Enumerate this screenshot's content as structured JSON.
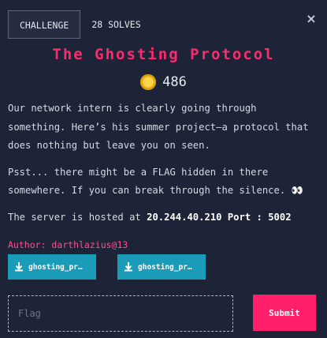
{
  "tabs": {
    "challenge": "CHALLENGE",
    "solves": "28 SOLVES"
  },
  "close_icon": "×",
  "title": "The Ghosting Protocol",
  "points": "486",
  "description": {
    "p1": "Our network intern is clearly going through something. Here’s his summer project—a protocol that does nothing but leave you on seen.",
    "p2": "Psst... there might be a FLAG hidden in there somewhere. If you can break through the silence. 👀",
    "p3_prefix": "The server is hosted at ",
    "p3_address": "20.244.40.210 Port : 5002"
  },
  "author": "Author: darthlazius@13",
  "downloads": [
    {
      "label": "ghosting_pr…"
    },
    {
      "label": "ghosting_pr…"
    }
  ],
  "flag_input": {
    "placeholder": "Flag",
    "value": ""
  },
  "submit_label": "Submit",
  "colors": {
    "accent": "#ff2a6d",
    "button": "#1a9bb8",
    "background": "#1e2437",
    "submit": "#ff1f6a"
  }
}
